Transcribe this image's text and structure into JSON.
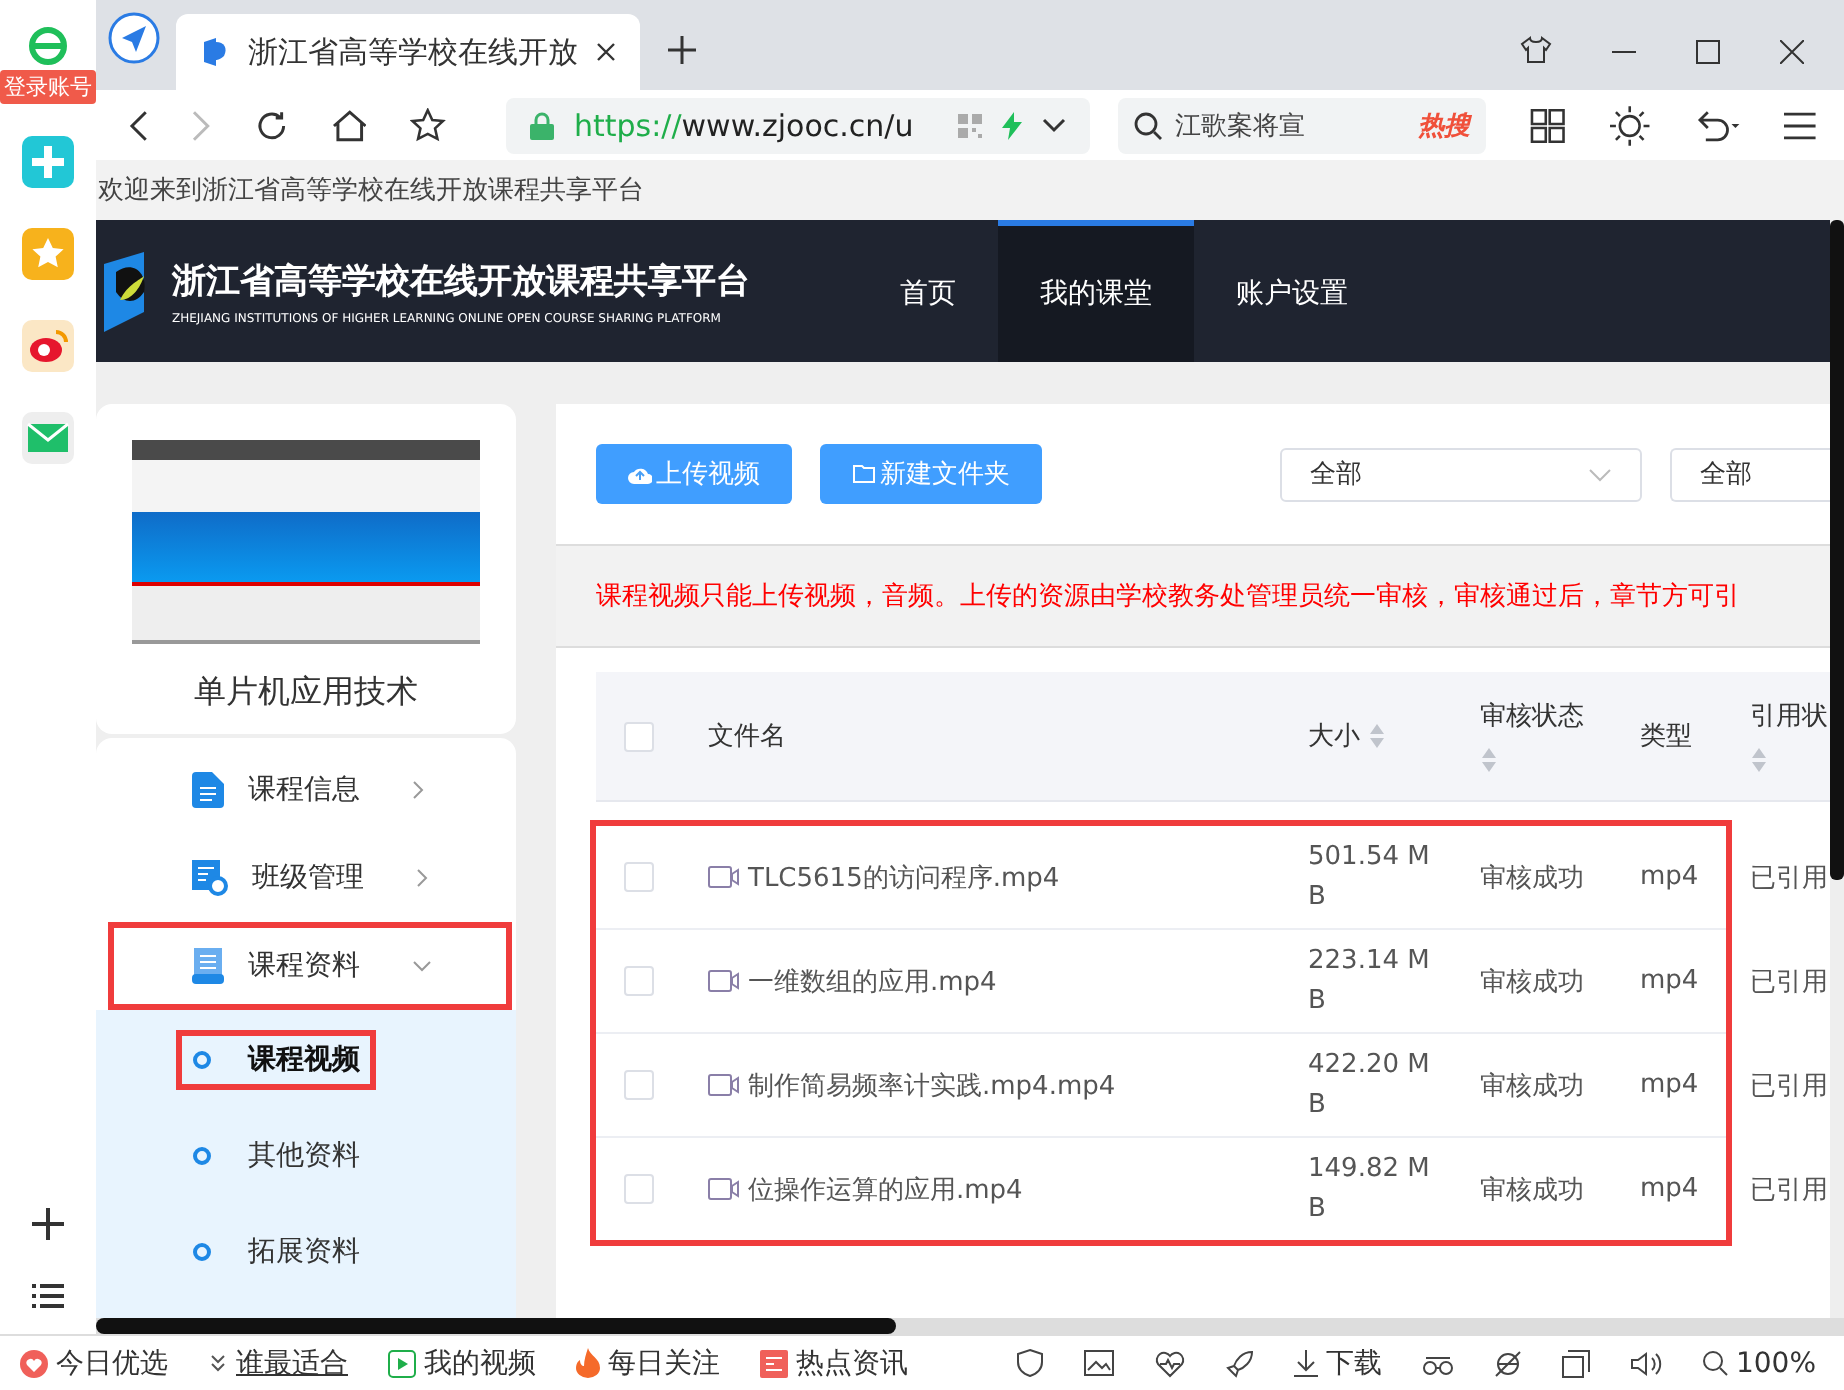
{
  "browser": {
    "login_badge": "登录账号",
    "tab": {
      "title": "浙江省高等学校在线开放",
      "selected": true
    },
    "address": {
      "scheme": "https://",
      "host": "www.zjooc.cn/u"
    },
    "search": {
      "value": "江歌案将宣",
      "hot_badge": "热搜"
    },
    "info_bar": "欢迎来到浙江省高等学校在线开放课程共享平台"
  },
  "site": {
    "title": "浙江省高等学校在线开放课程共享平台",
    "subtitle": "ZHEJIANG INSTITUTIONS OF HIGHER LEARNING ONLINE OPEN COURSE SHARING PLATFORM",
    "nav": [
      {
        "label": "首页",
        "selected": false
      },
      {
        "label": "我的课堂",
        "selected": true
      },
      {
        "label": "账户设置",
        "selected": false
      }
    ]
  },
  "course": {
    "name": "单片机应用技术"
  },
  "menu": [
    {
      "label": "课程信息",
      "kind": "info",
      "expanded": false,
      "highlighted": false
    },
    {
      "label": "班级管理",
      "kind": "class",
      "expanded": false,
      "highlighted": false
    },
    {
      "label": "课程资料",
      "kind": "material",
      "expanded": true,
      "highlighted": true,
      "children": [
        {
          "label": "课程视频",
          "selected": true,
          "highlighted": true
        },
        {
          "label": "其他资料",
          "selected": false,
          "highlighted": false
        },
        {
          "label": "拓展资料",
          "selected": false,
          "highlighted": false
        }
      ]
    }
  ],
  "toolbar": {
    "buttons": [
      {
        "label": "上传视频",
        "kind": "upload"
      },
      {
        "label": "新建文件夹",
        "kind": "folder"
      }
    ],
    "filters": [
      "全部",
      "全部"
    ]
  },
  "notice": "课程视频只能上传视频，音频。上传的资源由学校教务处管理员统一审核，审核通过后，章节方可引",
  "table": {
    "select_all": {
      "checked": false
    },
    "highlighted": true,
    "columns": [
      {
        "label": "文件名",
        "sortable": false
      },
      {
        "label": "大小",
        "sortable": true
      },
      {
        "label": "审核状态",
        "sortable": true
      },
      {
        "label": "类型",
        "sortable": false
      },
      {
        "label": "引用状",
        "sortable": true
      }
    ],
    "rows": [
      {
        "checked": false,
        "name": "TLC5615的访问程序.mp4",
        "size": "501.54 MB",
        "status": "审核成功",
        "type": "mp4",
        "reference": "已引用"
      },
      {
        "checked": false,
        "name": "一维数组的应用.mp4",
        "size": "223.14 MB",
        "status": "审核成功",
        "type": "mp4",
        "reference": "已引用"
      },
      {
        "checked": false,
        "name": "制作简易频率计实践.mp4.mp4",
        "size": "422.20 MB",
        "status": "审核成功",
        "type": "mp4",
        "reference": "已引用"
      },
      {
        "checked": false,
        "name": "位操作运算的应用.mp4",
        "size": "149.82 MB",
        "status": "审核成功",
        "type": "mp4",
        "reference": "已引用"
      }
    ]
  },
  "status_bar": {
    "items": [
      {
        "label": "今日优选",
        "kind": "heart"
      },
      {
        "label": "谁最适合",
        "kind": "chevron"
      },
      {
        "label": "我的视频",
        "kind": "play"
      },
      {
        "label": "每日关注",
        "kind": "flame"
      },
      {
        "label": "热点资讯",
        "kind": "news"
      }
    ],
    "download": "下载",
    "zoom": "100%"
  }
}
